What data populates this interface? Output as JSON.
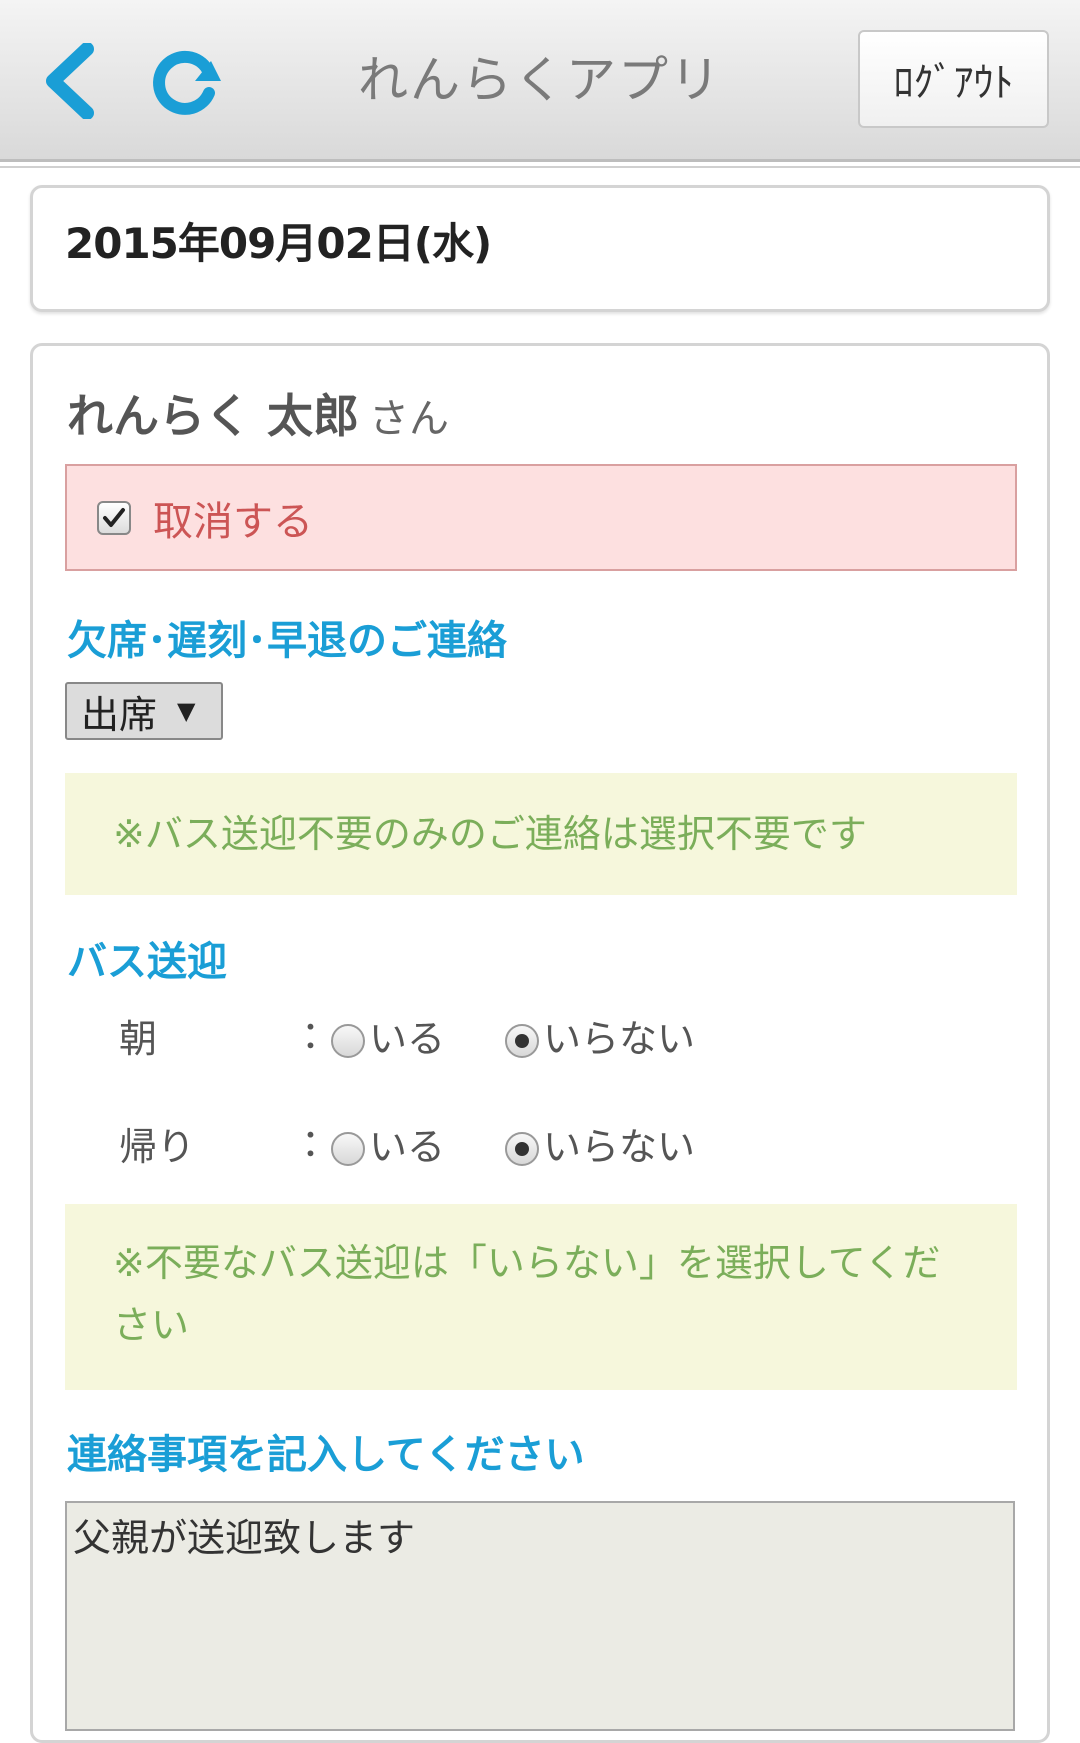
{
  "header": {
    "title": "れんらくアプリ",
    "logout_label": "ﾛｸﾞｱｳﾄ",
    "back_icon": "chevron-left-icon",
    "reload_icon": "reload-icon",
    "accent_color": "#1a9ed6"
  },
  "date": {
    "text": "2015年09月02日(水)"
  },
  "person": {
    "name": "れんらく 太郎",
    "suffix": "さん"
  },
  "cancel": {
    "label": "取消する",
    "checked": true
  },
  "absence": {
    "heading": "欠席･遅刻･早退のご連絡",
    "selected": "出席"
  },
  "note1": "※バス送迎不要のみのご連絡は選択不要です",
  "bus": {
    "heading": "バス送迎",
    "rows": [
      {
        "label": "朝",
        "colon": "：",
        "option_yes": "いる",
        "option_no": "いらない",
        "selected": "いらない"
      },
      {
        "label": "帰り",
        "colon": "：",
        "option_yes": "いる",
        "option_no": "いらない",
        "selected": "いらない"
      }
    ]
  },
  "note2": "※不要なバス送迎は「いらない」を選択してください",
  "message": {
    "heading": "連絡事項を記入してください",
    "value": "父親が送迎致します"
  }
}
